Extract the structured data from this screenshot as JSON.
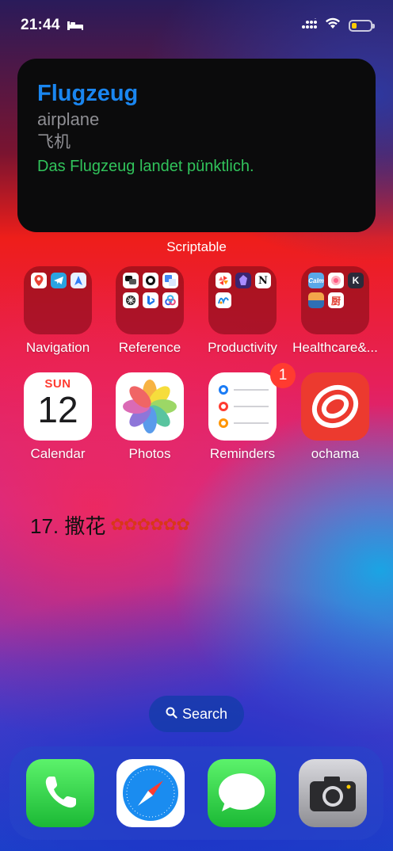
{
  "status_bar": {
    "time": "21:44",
    "icons": [
      "bed-icon",
      "cellular-icon",
      "wifi-icon",
      "battery-low-icon"
    ],
    "battery_color": "#ffcc00"
  },
  "widget": {
    "word": "Flugzeug",
    "translation_en": "airplane",
    "translation_zh": "飞机",
    "example": "Das Flugzeug landet pünktlich.",
    "label": "Scriptable",
    "colors": {
      "word": "#1a86f0",
      "example": "#31c35b"
    }
  },
  "row1": [
    {
      "label": "Navigation"
    },
    {
      "label": "Reference"
    },
    {
      "label": "Productivity"
    },
    {
      "label": "Healthcare&..."
    }
  ],
  "row2": [
    {
      "label": "Calendar",
      "day": "SUN",
      "date": "12"
    },
    {
      "label": "Photos"
    },
    {
      "label": "Reminders",
      "badge": "1"
    },
    {
      "label": "ochama"
    }
  ],
  "text_widget": {
    "text": "17. 撒花",
    "stars": "✿✿✿✿✿✿"
  },
  "search": {
    "label": "Search",
    "icon": "search-icon"
  },
  "dock": [
    "phone-icon",
    "safari-icon",
    "messages-icon",
    "camera-icon"
  ]
}
